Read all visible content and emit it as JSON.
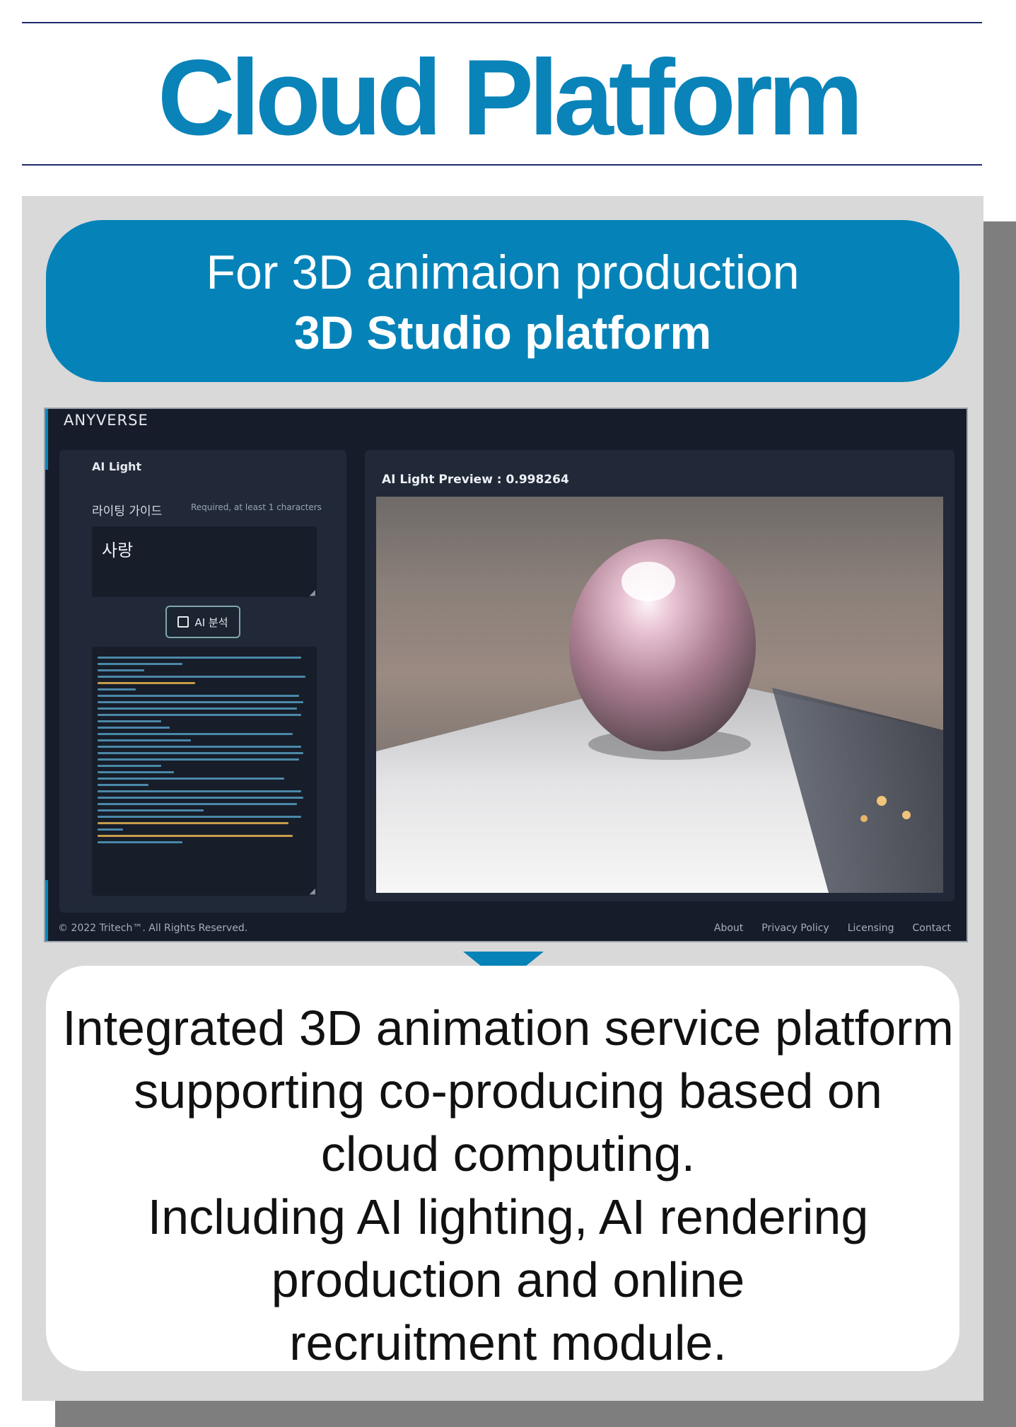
{
  "header": {
    "title": "Cloud Platform"
  },
  "banner": {
    "line1": "For 3D animaion production",
    "line2": "3D Studio platform"
  },
  "app": {
    "brand": "ANYVERSE",
    "left_panel": {
      "title": "AI Light",
      "guide_label": "라이팅 가이드",
      "guide_hint": "Required, at least 1 characters",
      "input_value": "사랑",
      "button_label": "AI 분석"
    },
    "preview": {
      "label": "AI Light Preview : 0.998264"
    },
    "footer": {
      "copyright": "© 2022 Tritech™. All Rights Reserved.",
      "links": [
        "About",
        "Privacy Policy",
        "Licensing",
        "Contact"
      ]
    }
  },
  "description": "Integrated 3D animation service platform\nsupporting co-producing based on\ncloud computing.\nIncluding AI lighting, AI rendering\nproduction and online\nrecruitment module.",
  "colors": {
    "brand_blue": "#0a83b9",
    "banner_blue": "#0583b8",
    "app_bg": "#161c29"
  }
}
